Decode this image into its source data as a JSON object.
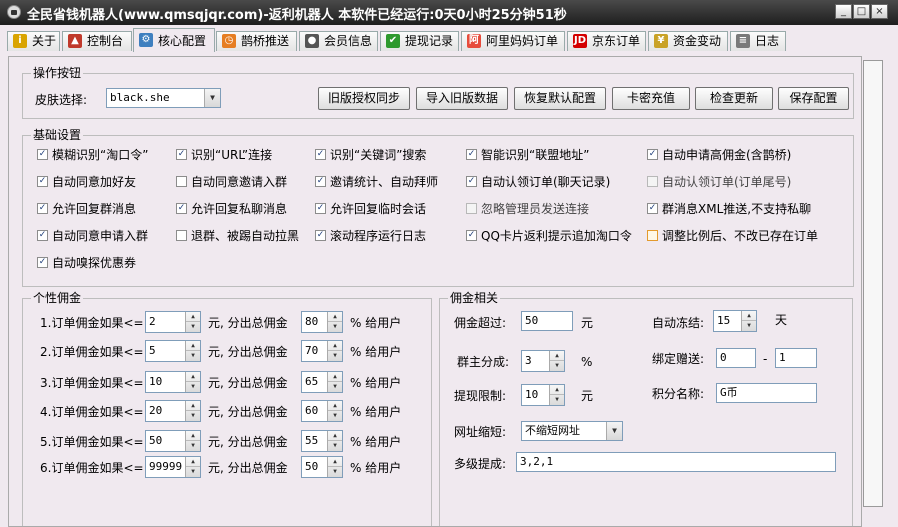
{
  "window": {
    "title": "全民省钱机器人(www.qmsqjqr.com)-返利机器人  本软件已经运行:0天0小时25分钟51秒",
    "controls": {
      "minimize": "_",
      "maximize": "□",
      "close": "×"
    }
  },
  "tabs": [
    {
      "label": "关于",
      "icon": "info-icon",
      "color": "#d9a400"
    },
    {
      "label": "控制台",
      "icon": "control-icon",
      "color": "#c0392b"
    },
    {
      "label": "核心配置",
      "icon": "config-icon",
      "color": "#3f7fbf",
      "active": true
    },
    {
      "label": "鹊桥推送",
      "icon": "clock-icon",
      "color": "#e67e22"
    },
    {
      "label": "会员信息",
      "icon": "member-icon",
      "color": "#555555"
    },
    {
      "label": "提现记录",
      "icon": "withdraw-icon",
      "color": "#2e9a2e"
    },
    {
      "label": "阿里妈妈订单",
      "icon": "alimama-icon",
      "color": "#e74c3c"
    },
    {
      "label": "京东订单",
      "icon": "jd-icon",
      "color": "#d40000"
    },
    {
      "label": "资金变动",
      "icon": "money-icon",
      "color": "#c9a227"
    },
    {
      "label": "日志",
      "icon": "log-icon",
      "color": "#7a7a7a"
    }
  ],
  "ops": {
    "title": "操作按钮",
    "skin_label": "皮肤选择:",
    "skin_value": "black.she",
    "buttons": [
      "旧版授权同步",
      "导入旧版数据",
      "恢复默认配置",
      "卡密充值",
      "检查更新",
      "保存配置"
    ]
  },
  "basic": {
    "title": "基础设置",
    "rows": [
      [
        {
          "label": "模糊识别“淘口令”",
          "checked": true
        },
        {
          "label": "识别“URL”连接",
          "checked": true
        },
        {
          "label": "识别“关键词”搜索",
          "checked": true
        },
        {
          "label": "智能识别“联盟地址”",
          "checked": true
        },
        {
          "label": "自动申请高佣金(含鹊桥)",
          "checked": true
        }
      ],
      [
        {
          "label": "自动同意加好友",
          "checked": true
        },
        {
          "label": "自动同意邀请入群",
          "checked": false
        },
        {
          "label": "邀请统计、自动拜师",
          "checked": true
        },
        {
          "label": "自动认领订单(聊天记录)",
          "checked": true
        },
        {
          "label": "自动认领订单(订单尾号)",
          "checked": false,
          "dim": true
        }
      ],
      [
        {
          "label": "允许回复群消息",
          "checked": true
        },
        {
          "label": "允许回复私聊消息",
          "checked": true
        },
        {
          "label": "允许回复临时会话",
          "checked": true
        },
        {
          "label": "忽略管理员发送连接",
          "checked": false,
          "dim": true
        },
        {
          "label": "群消息XML推送,不支持私聊",
          "checked": true
        }
      ],
      [
        {
          "label": "自动同意申请入群",
          "checked": true
        },
        {
          "label": "退群、被踢自动拉黑",
          "checked": false
        },
        {
          "label": "滚动程序运行日志",
          "checked": true
        },
        {
          "label": "QQ卡片返利提示追加淘口令",
          "checked": true
        },
        {
          "label": "调整比例后、不改已存在订单",
          "checked": false,
          "highlight": true
        }
      ],
      [
        {
          "label": "自动嗅探优惠券",
          "checked": true
        }
      ]
    ]
  },
  "personal": {
    "title": "个性佣金",
    "mid_text": "元, 分出总佣金",
    "end_text": "% 给用户",
    "rows": [
      {
        "label": "1.订单佣金如果<=",
        "threshold": "2",
        "percent": "80"
      },
      {
        "label": "2.订单佣金如果<=",
        "threshold": "5",
        "percent": "70"
      },
      {
        "label": "3.订单佣金如果<=",
        "threshold": "10",
        "percent": "65"
      },
      {
        "label": "4.订单佣金如果<=",
        "threshold": "20",
        "percent": "60"
      },
      {
        "label": "5.订单佣金如果<=",
        "threshold": "50",
        "percent": "55"
      },
      {
        "label": "6.订单佣金如果<=",
        "threshold": "99999",
        "percent": "50"
      }
    ]
  },
  "commission": {
    "title": "佣金相关",
    "exceed_label": "佣金超过:",
    "exceed_value": "50",
    "exceed_unit": "元",
    "freeze_label": "自动冻结:",
    "freeze_value": "15",
    "freeze_unit": "天",
    "owner_label": "群主分成:",
    "owner_value": "3",
    "owner_unit": "%",
    "bind_label": "绑定赠送:",
    "bind_from": "0",
    "bind_dash": "-",
    "bind_to": "1",
    "withdraw_label": "提现限制:",
    "withdraw_value": "10",
    "withdraw_unit": "元",
    "points_label": "积分名称:",
    "points_value": "G币",
    "url_label": "网址缩短:",
    "url_value": "不缩短网址",
    "multi_label": "多级提成:",
    "multi_value": "3,2,1"
  },
  "colors": {
    "accent": "#1f3d7a",
    "titlebar": "#2b2b2b",
    "panel": "#f0e9ef"
  }
}
